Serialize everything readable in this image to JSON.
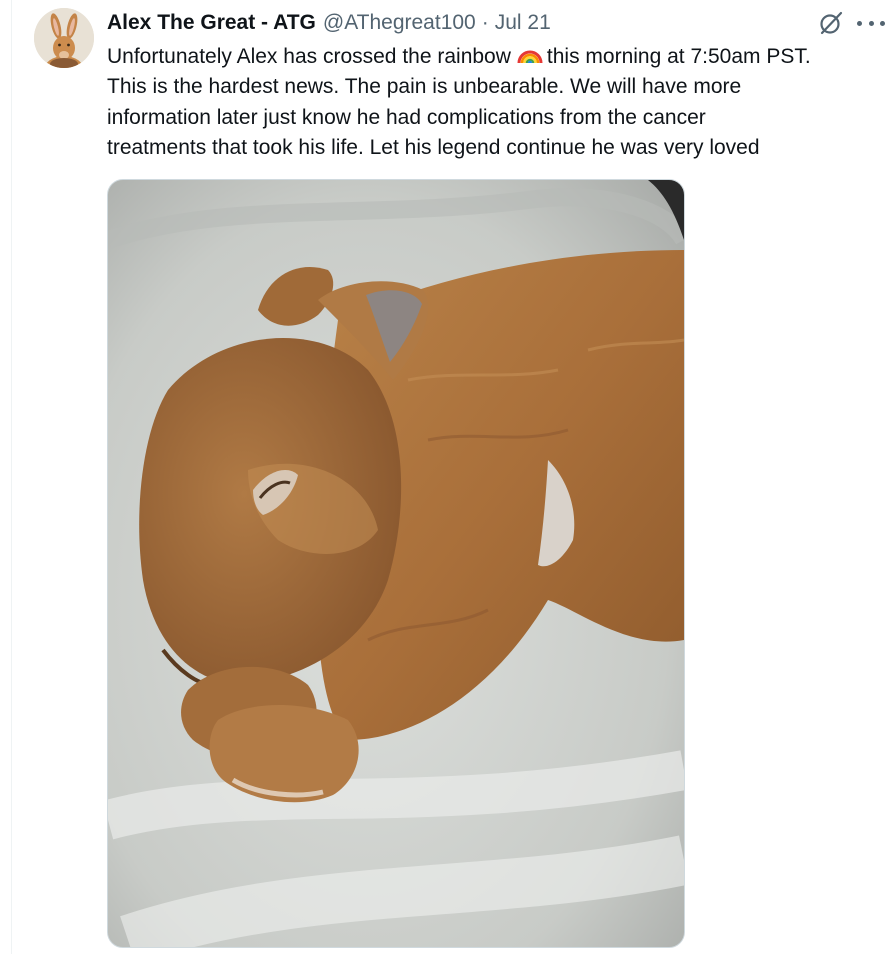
{
  "tweet": {
    "display_name": "Alex The Great - ATG",
    "handle": "@AThegreat100",
    "separator": "·",
    "date": "Jul 21",
    "text_lines": [
      "Unfortunately Alex has crossed the rainbow",
      "this morning at 7:50am PST.",
      "This is the hardest news. The pain is unbearable. We will have more",
      "information later just know he had complications from the cancer",
      "treatments that took his life. Let his legend continue he was very loved"
    ],
    "emoji": "rainbow-emoji",
    "media": {
      "subject": "sleeping-rabbit-photo"
    }
  },
  "icons": {
    "avatar": "rabbit-avatar",
    "grok": "grok-icon",
    "more": "more-icon"
  },
  "colors": {
    "text_primary": "#0f1419",
    "text_secondary": "#536471",
    "border": "#cfd9de"
  }
}
